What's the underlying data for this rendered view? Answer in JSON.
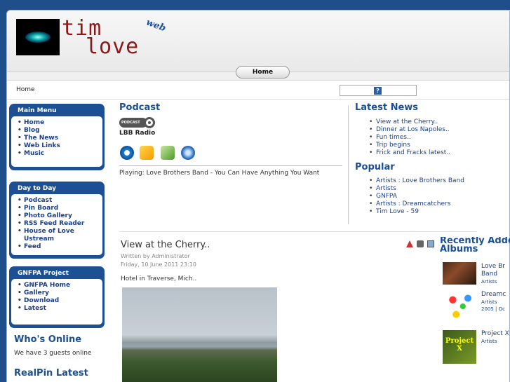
{
  "header": {
    "logo_line1": "tim",
    "logo_line2": "love",
    "logo_web": "web",
    "nav_home": "Home"
  },
  "breadcrumb": "Home",
  "search": {
    "button": "?"
  },
  "main_menu": {
    "title": "Main Menu",
    "items": [
      "Home",
      "Blog",
      "The News",
      "Web Links",
      "Music"
    ]
  },
  "day_to_day": {
    "title": "Day to Day",
    "items": [
      "Podcast",
      "Pin Board",
      "Photo Gallery",
      "RSS Feed Reader",
      "House of Love Ustream",
      "Feed"
    ]
  },
  "gnfpa": {
    "title": "GNFPA Project",
    "items": [
      "GNFPA Home",
      "Gallery",
      "Download",
      "Latest"
    ]
  },
  "whos_online": {
    "title": "Who's Online",
    "text": "We have 3 guests online"
  },
  "realpin": {
    "title": "RealPin Latest"
  },
  "podcast": {
    "title": "Podcast",
    "badge": "PODCAST",
    "station": "LBB Radio",
    "playing": "Playing: Love Brothers Band - You Can Have Anything You Want"
  },
  "latest_news": {
    "title": "Latest News",
    "items": [
      "View at the Cherry..",
      "Dinner at Los Napoles..",
      "Fun times..",
      "Trip begins",
      "Frick and Fracks latest.."
    ]
  },
  "popular": {
    "title": "Popular",
    "items": [
      "Artists : Love Brothers Band",
      "Artists",
      "GNFPA",
      "Artists : Dreamcatchers",
      "Tim Love - 59"
    ]
  },
  "article": {
    "title": "View at the Cherry..",
    "author": "Written by Administrator",
    "date": "Friday, 10 June 2011 23:10",
    "body": "Hotel in Traverse, Mich.."
  },
  "recent_albums": {
    "title_line1": "Recently Added",
    "title_line2": "Albums",
    "albums": [
      {
        "name1": "Love Br",
        "name2": "Band",
        "cat": "Artists",
        "extra": ""
      },
      {
        "name1": "Dreamc",
        "name2": "",
        "cat": "Artists",
        "extra": "2005 | Oc"
      },
      {
        "name1": "Project X",
        "name2": "",
        "cat": "Artists",
        "extra": ""
      }
    ],
    "thumb3_label_1": "Project",
    "thumb3_label_2": "X"
  },
  "colors": {
    "page_bg": "#1e4f8a",
    "module_bg": "#1c4f94",
    "link": "#1b3f8a",
    "logo_text": "#8a1a1a"
  }
}
